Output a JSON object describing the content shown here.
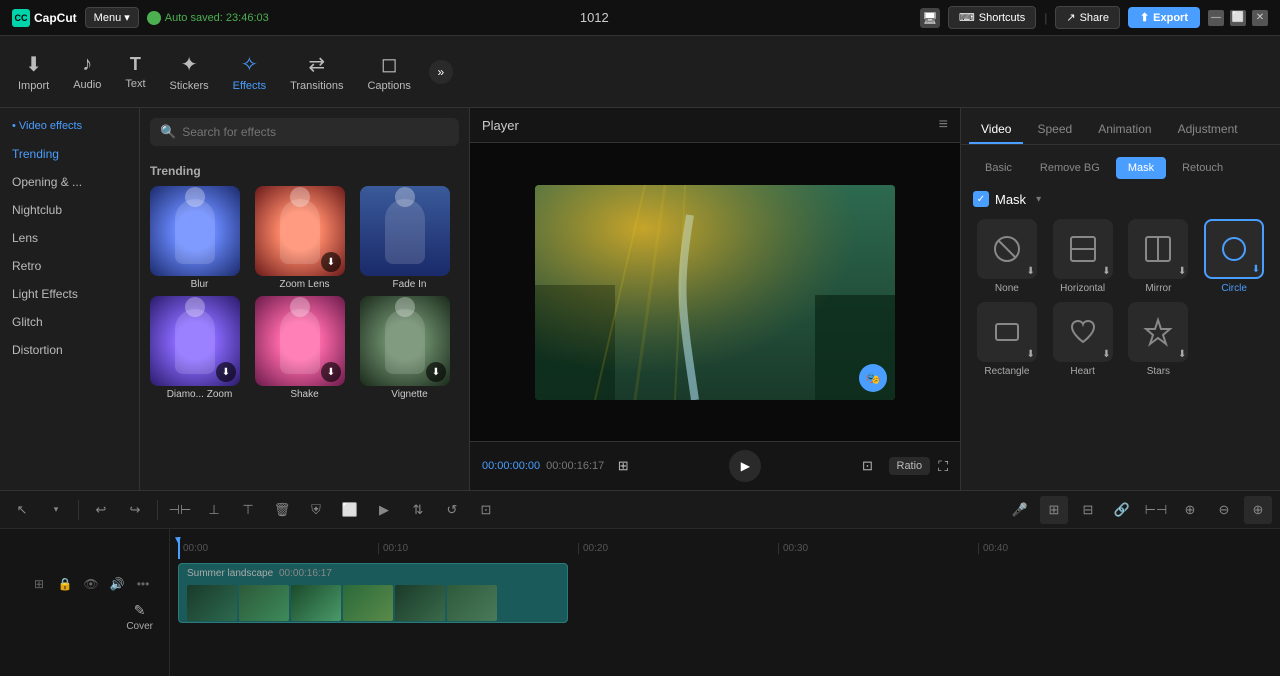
{
  "app": {
    "name": "CapCut",
    "logo_text": "CC",
    "menu_label": "Menu ▾"
  },
  "titlebar": {
    "autosave_text": "Auto saved: 23:46:03",
    "video_id": "1012",
    "shortcuts_label": "Shortcuts",
    "share_label": "Share",
    "export_label": "Export"
  },
  "toolbar": {
    "items": [
      {
        "id": "import",
        "label": "Import",
        "icon": "⬇"
      },
      {
        "id": "audio",
        "label": "Audio",
        "icon": "♪"
      },
      {
        "id": "text",
        "label": "Text",
        "icon": "T"
      },
      {
        "id": "stickers",
        "label": "Stickers",
        "icon": "✦"
      },
      {
        "id": "effects",
        "label": "Effects",
        "icon": "✧"
      },
      {
        "id": "transitions",
        "label": "Transitions",
        "icon": "⇄"
      },
      {
        "id": "captions",
        "label": "Captions",
        "icon": "◻"
      }
    ],
    "more_icon": "»"
  },
  "left_panel": {
    "section_label": "Video effects",
    "items": [
      {
        "id": "trending",
        "label": "Trending",
        "active": true
      },
      {
        "id": "opening",
        "label": "Opening & ..."
      },
      {
        "id": "nightclub",
        "label": "Nightclub"
      },
      {
        "id": "lens",
        "label": "Lens"
      },
      {
        "id": "retro",
        "label": "Retro"
      },
      {
        "id": "light_effects",
        "label": "Light Effects"
      },
      {
        "id": "glitch",
        "label": "Glitch"
      },
      {
        "id": "distortion",
        "label": "Distortion"
      }
    ]
  },
  "effects_panel": {
    "search_placeholder": "Search for effects",
    "trending_title": "Trending",
    "effects": [
      {
        "id": "blur",
        "label": "Blur",
        "color": "ec-blue"
      },
      {
        "id": "zoom_lens",
        "label": "Zoom Lens",
        "color": "ec-red"
      },
      {
        "id": "fade_in",
        "label": "Fade In",
        "color": "ec-purple"
      },
      {
        "id": "diamond_zoom",
        "label": "Diamo... Zoom",
        "color": "ec-purple"
      },
      {
        "id": "shake",
        "label": "Shake",
        "color": "ec-pink"
      },
      {
        "id": "vignette",
        "label": "Vignette",
        "color": "ec-green"
      }
    ]
  },
  "player": {
    "title": "Player",
    "time_current": "00:00:00:00",
    "time_total": "00:00:16:17",
    "ratio_label": "Ratio"
  },
  "right_panel": {
    "tabs": [
      {
        "id": "video",
        "label": "Video",
        "active": true
      },
      {
        "id": "speed",
        "label": "Speed"
      },
      {
        "id": "animation",
        "label": "Animation"
      },
      {
        "id": "adjustment",
        "label": "Adjustment"
      }
    ],
    "sub_tabs": [
      {
        "id": "basic",
        "label": "Basic"
      },
      {
        "id": "remove_bg",
        "label": "Remove BG"
      },
      {
        "id": "mask",
        "label": "Mask",
        "active": true
      },
      {
        "id": "retouch",
        "label": "Retouch"
      }
    ],
    "mask_label": "Mask",
    "mask_items": [
      {
        "id": "none",
        "label": "None",
        "icon": "⊘",
        "selected": false
      },
      {
        "id": "horizontal",
        "label": "Horizontal",
        "icon": "▭",
        "selected": false
      },
      {
        "id": "mirror",
        "label": "Mirror",
        "icon": "▱",
        "selected": false
      },
      {
        "id": "circle",
        "label": "Circle",
        "icon": "◯",
        "selected": true
      },
      {
        "id": "rectangle",
        "label": "Rectangle",
        "icon": "▢",
        "selected": false
      },
      {
        "id": "heart",
        "label": "Heart",
        "icon": "♡",
        "selected": false
      },
      {
        "id": "stars",
        "label": "Stars",
        "icon": "☆",
        "selected": false
      }
    ]
  },
  "timeline": {
    "clip_title": "Summer landscape",
    "clip_duration": "00:00:16:17",
    "cover_label": "Cover",
    "ruler_marks": [
      "00:00",
      "00:10",
      "00:20",
      "00:30",
      "00:40"
    ]
  }
}
